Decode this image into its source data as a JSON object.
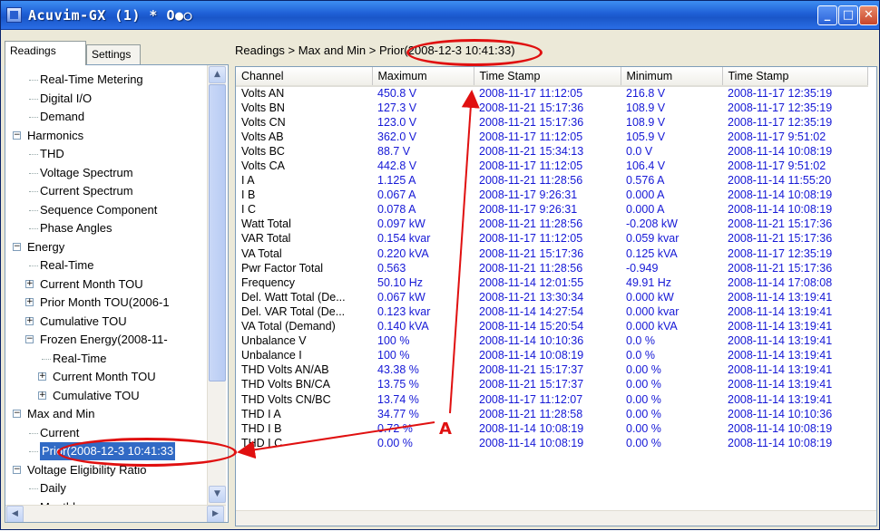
{
  "window": {
    "title": "Acuvim-GX (1) * O●○",
    "min_glyph": "_",
    "max_glyph": "□",
    "close_glyph": "✕"
  },
  "tabs": [
    {
      "label": "Readings"
    },
    {
      "label": "Settings"
    }
  ],
  "breadcrumb": "Readings > Max and Min > Prior(2008-12-3 10:41:33)",
  "tree": [
    {
      "label": "Real-Time Metering"
    },
    {
      "label": "Digital I/O"
    },
    {
      "label": "Demand"
    },
    {
      "label": "Harmonics",
      "toggle": "−"
    },
    {
      "label": "THD"
    },
    {
      "label": "Voltage Spectrum"
    },
    {
      "label": "Current Spectrum"
    },
    {
      "label": "Sequence Component"
    },
    {
      "label": "Phase Angles"
    },
    {
      "label": "Energy",
      "toggle": "−"
    },
    {
      "label": "Real-Time"
    },
    {
      "label": "Current Month TOU",
      "toggle": "+"
    },
    {
      "label": "Prior Month TOU(2006-1",
      "toggle": "+"
    },
    {
      "label": "Cumulative TOU",
      "toggle": "+"
    },
    {
      "label": "Frozen Energy(2008-11-",
      "toggle": "−"
    },
    {
      "label": "Real-Time"
    },
    {
      "label": "Current Month TOU",
      "toggle": "+"
    },
    {
      "label": "Cumulative TOU",
      "toggle": "+"
    },
    {
      "label": "Max and Min",
      "toggle": "−"
    },
    {
      "label": "Current"
    },
    {
      "label": "Prior(2008-12-3 10:41:33",
      "selected": true
    },
    {
      "label": "Voltage Eligibility Ratio",
      "toggle": "−"
    },
    {
      "label": "Daily"
    },
    {
      "label": "Monthly"
    }
  ],
  "grid": {
    "columns": [
      "Channel",
      "Maximum",
      "Time Stamp",
      "Minimum",
      "Time Stamp"
    ],
    "rows": [
      [
        "Volts AN",
        "450.8 V",
        "2008-11-17 11:12:05",
        "216.8 V",
        "2008-11-17 12:35:19"
      ],
      [
        "Volts BN",
        "127.3 V",
        "2008-11-21 15:17:36",
        "108.9 V",
        "2008-11-17 12:35:19"
      ],
      [
        "Volts CN",
        "123.0 V",
        "2008-11-21 15:17:36",
        "108.9 V",
        "2008-11-17 12:35:19"
      ],
      [
        "Volts AB",
        "362.0 V",
        "2008-11-17 11:12:05",
        "105.9 V",
        "2008-11-17 9:51:02"
      ],
      [
        "Volts BC",
        "88.7 V",
        "2008-11-21 15:34:13",
        "0.0 V",
        "2008-11-14 10:08:19"
      ],
      [
        "Volts CA",
        "442.8 V",
        "2008-11-17 11:12:05",
        "106.4 V",
        "2008-11-17 9:51:02"
      ],
      [
        "I A",
        "1.125 A",
        "2008-11-21 11:28:56",
        "0.576 A",
        "2008-11-14 11:55:20"
      ],
      [
        "I B",
        "0.067 A",
        "2008-11-17 9:26:31",
        "0.000 A",
        "2008-11-14 10:08:19"
      ],
      [
        "I C",
        "0.078 A",
        "2008-11-17 9:26:31",
        "0.000 A",
        "2008-11-14 10:08:19"
      ],
      [
        "Watt Total",
        "0.097 kW",
        "2008-11-21 11:28:56",
        "-0.208 kW",
        "2008-11-21 15:17:36"
      ],
      [
        "VAR Total",
        "0.154 kvar",
        "2008-11-17 11:12:05",
        "0.059 kvar",
        "2008-11-21 15:17:36"
      ],
      [
        "VA Total",
        "0.220 kVA",
        "2008-11-21 15:17:36",
        "0.125 kVA",
        "2008-11-17 12:35:19"
      ],
      [
        "Pwr Factor Total",
        "0.563",
        "2008-11-21 11:28:56",
        "-0.949",
        "2008-11-21 15:17:36"
      ],
      [
        "Frequency",
        "50.10 Hz",
        "2008-11-14 12:01:55",
        "49.91 Hz",
        "2008-11-14 17:08:08"
      ],
      [
        "Del. Watt Total (De...",
        "0.067 kW",
        "2008-11-21 13:30:34",
        "0.000 kW",
        "2008-11-14 13:19:41"
      ],
      [
        "Del. VAR Total (De...",
        "0.123 kvar",
        "2008-11-14 14:27:54",
        "0.000 kvar",
        "2008-11-14 13:19:41"
      ],
      [
        "VA Total (Demand)",
        "0.140 kVA",
        "2008-11-14 15:20:54",
        "0.000 kVA",
        "2008-11-14 13:19:41"
      ],
      [
        "Unbalance V",
        "100 %",
        "2008-11-14 10:10:36",
        "0.0 %",
        "2008-11-14 13:19:41"
      ],
      [
        "Unbalance I",
        "100 %",
        "2008-11-14 10:08:19",
        "0.0 %",
        "2008-11-14 13:19:41"
      ],
      [
        "THD Volts AN/AB",
        "43.38 %",
        "2008-11-21 15:17:37",
        "0.00 %",
        "2008-11-14 13:19:41"
      ],
      [
        "THD Volts BN/CA",
        "13.75 %",
        "2008-11-21 15:17:37",
        "0.00 %",
        "2008-11-14 13:19:41"
      ],
      [
        "THD Volts CN/BC",
        "13.74 %",
        "2008-11-17 11:12:07",
        "0.00 %",
        "2008-11-14 13:19:41"
      ],
      [
        "THD I A",
        "34.77 %",
        "2008-11-21 11:28:58",
        "0.00 %",
        "2008-11-14 10:10:36"
      ],
      [
        "THD I B",
        "0.72 %",
        "2008-11-14 10:08:19",
        "0.00 %",
        "2008-11-14 10:08:19"
      ],
      [
        "THD I C",
        "0.00 %",
        "2008-11-14 10:08:19",
        "0.00 %",
        "2008-11-14 10:08:19"
      ]
    ]
  },
  "annotation": {
    "label": "A",
    "color": "#e01010"
  },
  "colors": {
    "value_text": "#1518d6",
    "selection": "#316ac5",
    "title_bar": "#1f5fd6"
  }
}
